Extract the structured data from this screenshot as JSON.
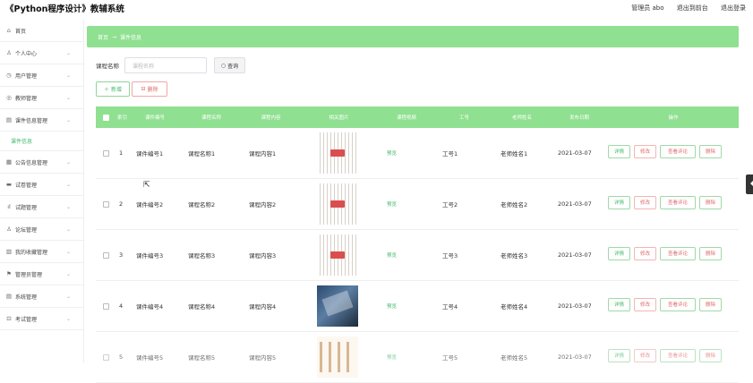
{
  "app": {
    "title": "《Python程序设计》教辅系统",
    "admin_label": "管理员 abo",
    "back_label": "退出到前台",
    "logout_label": "退出登录"
  },
  "sidebar": {
    "items": [
      {
        "label": "首页",
        "icon": "home-icon",
        "glyph": "⌂",
        "chevron": false
      },
      {
        "label": "个人中心",
        "icon": "user-icon",
        "glyph": "♙",
        "chevron": true
      },
      {
        "label": "用户管理",
        "icon": "users-icon",
        "glyph": "◷",
        "chevron": true
      },
      {
        "label": "教师管理",
        "icon": "teacher-icon",
        "glyph": "◎",
        "chevron": true
      },
      {
        "label": "课件信息管理",
        "icon": "courseware-icon",
        "glyph": "▤",
        "chevron": true
      },
      {
        "label": "课件信息",
        "sub": true
      },
      {
        "label": "公告信息管理",
        "icon": "notice-icon",
        "glyph": "▦",
        "chevron": true
      },
      {
        "label": "试卷管理",
        "icon": "paper-icon",
        "glyph": "▬",
        "chevron": true
      },
      {
        "label": "试题管理",
        "icon": "question-icon",
        "glyph": "ıl",
        "chevron": true
      },
      {
        "label": "论坛管理",
        "icon": "forum-icon",
        "glyph": "♙",
        "chevron": true
      },
      {
        "label": "我的收藏管理",
        "icon": "favorite-icon",
        "glyph": "▥",
        "chevron": true
      },
      {
        "label": "管理员管理",
        "icon": "admin-icon",
        "glyph": "⚑",
        "chevron": true
      },
      {
        "label": "系统管理",
        "icon": "system-icon",
        "glyph": "▤",
        "chevron": true
      },
      {
        "label": "考试管理",
        "icon": "exam-icon",
        "glyph": "⊡",
        "chevron": true
      }
    ]
  },
  "breadcrumb": {
    "home": "首页",
    "arrow": "→",
    "current": "课件信息"
  },
  "search": {
    "label": "课程名称",
    "placeholder": "课程名称",
    "button": "查询",
    "button_icon": "search-icon"
  },
  "actions": {
    "add": "＋ 新增",
    "delete": "删除",
    "delete_icon": "trash-icon"
  },
  "table": {
    "headers": [
      "索引",
      "课件编号",
      "课程名称",
      "课程内容",
      "相关图片",
      "课程视频",
      "工号",
      "老师姓名",
      "发布日期",
      "操作"
    ],
    "rows": [
      {
        "idx": "1",
        "code": "课件编号1",
        "name": "课程名称1",
        "content": "课程内容1",
        "image": "mind",
        "video": "预览",
        "no": "工号1",
        "teacher": "老师姓名1",
        "date": "2021-03-07"
      },
      {
        "idx": "2",
        "code": "课件编号2",
        "name": "课程名称2",
        "content": "课程内容2",
        "image": "mind",
        "video": "预览",
        "no": "工号2",
        "teacher": "老师姓名2",
        "date": "2021-03-07"
      },
      {
        "idx": "3",
        "code": "课件编号3",
        "name": "课程名称3",
        "content": "课程内容3",
        "image": "mind",
        "video": "预览",
        "no": "工号3",
        "teacher": "老师姓名3",
        "date": "2021-03-07"
      },
      {
        "idx": "4",
        "code": "课件编号4",
        "name": "课程名称4",
        "content": "课程内容4",
        "image": "dark",
        "video": "预览",
        "no": "工号4",
        "teacher": "老师姓名4",
        "date": "2021-03-07"
      },
      {
        "idx": "5",
        "code": "课件编号5",
        "name": "课程名称5",
        "content": "课程内容5",
        "image": "figs",
        "video": "预览",
        "no": "工号5",
        "teacher": "老师姓名5",
        "date": "2021-03-07"
      }
    ],
    "ops": {
      "detail": "详情",
      "edit": "修改",
      "review": "查看评论",
      "remove": "删除"
    }
  },
  "colors": {
    "accent": "#8fe090",
    "green_text": "#43b96b",
    "red_text": "#e06a6a"
  }
}
